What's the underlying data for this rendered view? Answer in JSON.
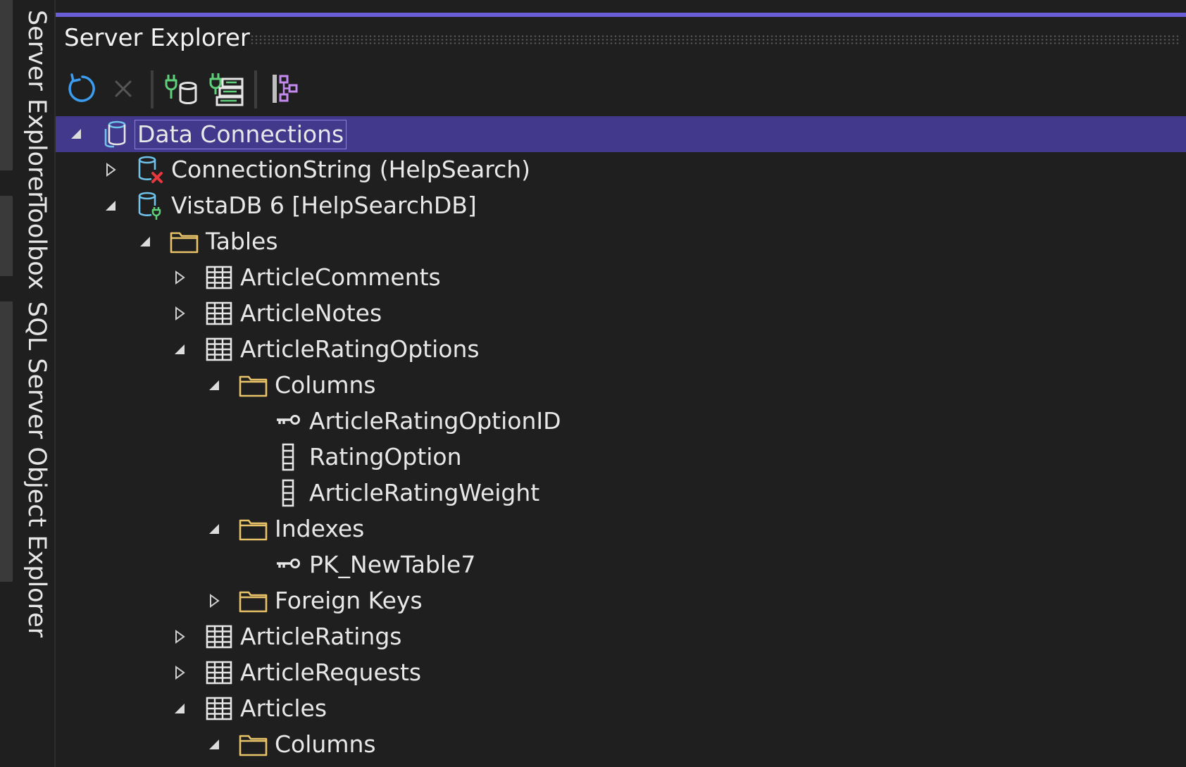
{
  "dock": {
    "tabs": [
      {
        "label": "Server Explorer"
      },
      {
        "label": "Toolbox"
      },
      {
        "label": "SQL Server Object Explorer"
      }
    ]
  },
  "panel": {
    "title": "Server Explorer",
    "accent_color": "#6a5dd6"
  },
  "toolbar": {
    "buttons": [
      {
        "name": "refresh-icon"
      },
      {
        "name": "stop-icon"
      },
      {
        "name": "connect-to-database-icon"
      },
      {
        "name": "connect-to-server-icon"
      },
      {
        "name": "dependency-diagram-icon"
      }
    ]
  },
  "tree": {
    "nodes": [
      {
        "label": "Data Connections",
        "level": 0,
        "expanded": true,
        "icon": "data-connections-icon",
        "selected": true
      },
      {
        "label": "ConnectionString (HelpSearch)",
        "level": 1,
        "expanded": false,
        "icon": "database-error-icon"
      },
      {
        "label": "VistaDB 6 [HelpSearchDB]",
        "level": 1,
        "expanded": true,
        "icon": "database-connected-icon"
      },
      {
        "label": "Tables",
        "level": 2,
        "expanded": true,
        "icon": "folder-icon"
      },
      {
        "label": "ArticleComments",
        "level": 3,
        "expanded": false,
        "icon": "table-icon"
      },
      {
        "label": "ArticleNotes",
        "level": 3,
        "expanded": false,
        "icon": "table-icon"
      },
      {
        "label": "ArticleRatingOptions",
        "level": 3,
        "expanded": true,
        "icon": "table-icon"
      },
      {
        "label": "Columns",
        "level": 4,
        "expanded": true,
        "icon": "folder-icon"
      },
      {
        "label": "ArticleRatingOptionID",
        "level": 5,
        "expanded": null,
        "icon": "key-icon"
      },
      {
        "label": "RatingOption",
        "level": 5,
        "expanded": null,
        "icon": "column-icon"
      },
      {
        "label": "ArticleRatingWeight",
        "level": 5,
        "expanded": null,
        "icon": "column-icon"
      },
      {
        "label": "Indexes",
        "level": 4,
        "expanded": true,
        "icon": "folder-icon"
      },
      {
        "label": "PK_NewTable7",
        "level": 5,
        "expanded": null,
        "icon": "key-icon"
      },
      {
        "label": "Foreign Keys",
        "level": 4,
        "expanded": false,
        "icon": "folder-icon"
      },
      {
        "label": "ArticleRatings",
        "level": 3,
        "expanded": false,
        "icon": "table-icon"
      },
      {
        "label": "ArticleRequests",
        "level": 3,
        "expanded": false,
        "icon": "table-icon"
      },
      {
        "label": "Articles",
        "level": 3,
        "expanded": true,
        "icon": "table-icon"
      },
      {
        "label": "Columns",
        "level": 4,
        "expanded": true,
        "icon": "folder-icon"
      }
    ]
  }
}
